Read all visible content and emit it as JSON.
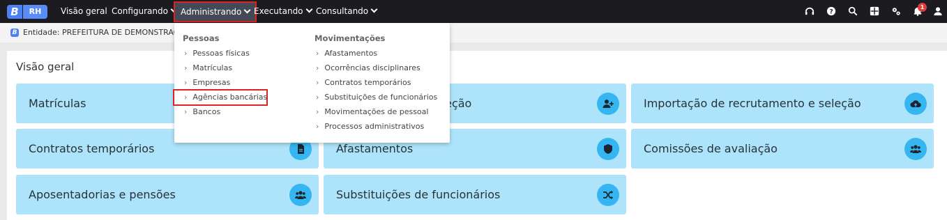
{
  "app": {
    "logo_letter": "B",
    "logo_text": "RH"
  },
  "nav": {
    "items": [
      {
        "label": "Visão geral",
        "has_dropdown": false
      },
      {
        "label": "Configurando",
        "has_dropdown": true
      },
      {
        "label": "Administrando",
        "has_dropdown": true,
        "active": true
      },
      {
        "label": "Executando",
        "has_dropdown": true
      },
      {
        "label": "Consultando",
        "has_dropdown": true
      }
    ],
    "notification_count": "1",
    "icons": [
      "headset-icon",
      "help-icon",
      "search-icon",
      "apps-grid-icon",
      "settings-icon",
      "bell-icon",
      "user-icon"
    ]
  },
  "entity": {
    "icon_letter": "B",
    "text": "Entidade: PREFEITURA DE DEMONSTRAÇÃO"
  },
  "main": {
    "title": "Visão geral",
    "cards": [
      {
        "label": "Matrículas",
        "icon": "none"
      },
      {
        "label": "Recrutamento e seleção",
        "icon": "person-add-icon"
      },
      {
        "label": "Importação de recrutamento e seleção",
        "icon": "cloud-upload-icon"
      },
      {
        "label": "Contratos temporários",
        "icon": "document-icon"
      },
      {
        "label": "Afastamentos",
        "icon": "shield-icon"
      },
      {
        "label": "Comissões de avaliação",
        "icon": "group-icon"
      },
      {
        "label": "Aposentadorias e pensões",
        "icon": "group-icon"
      },
      {
        "label": "Substituições de funcionários",
        "icon": "shuffle-icon"
      }
    ]
  },
  "dropdown": {
    "columns": [
      {
        "title": "Pessoas",
        "items": [
          "Pessoas físicas",
          "Matrículas",
          "Empresas",
          "Agências bancárias",
          "Bancos"
        ]
      },
      {
        "title": "Movimentações",
        "items": [
          "Afastamentos",
          "Ocorrências disciplinares",
          "Contratos temporários",
          "Substituições de funcionários",
          "Movimentações de pessoal",
          "Processos administrativos"
        ]
      }
    ],
    "highlighted_item": "Agências bancárias"
  },
  "colors": {
    "topbar": "#1b1b20",
    "card_bg": "#aee4fb",
    "card_icon_bg": "#35b6f0",
    "highlight_border": "#dd2222",
    "brand": "#4d7ff5"
  }
}
